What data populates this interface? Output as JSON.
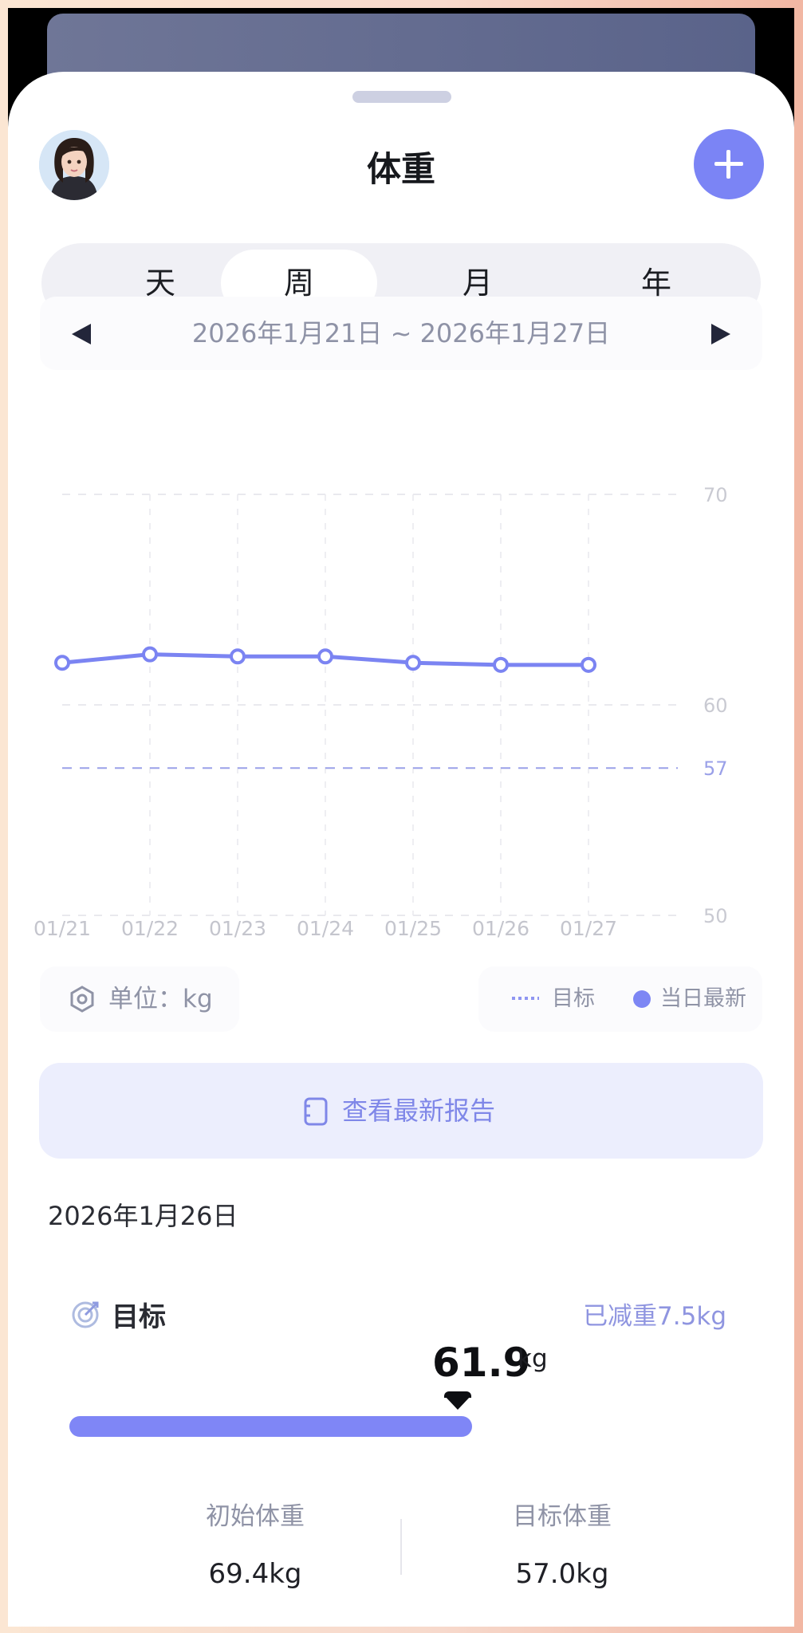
{
  "header": {
    "title": "体重"
  },
  "period_tabs": [
    "天",
    "周",
    "月",
    "年"
  ],
  "active_tab": "周",
  "date_range": "2026年1月21日 ~ 2026年1月27日",
  "chart_data": {
    "type": "line",
    "x": [
      "01/21",
      "01/22",
      "01/23",
      "01/24",
      "01/25",
      "01/26",
      "01/27"
    ],
    "series": [
      {
        "name": "当日最新",
        "values": [
          62.0,
          62.4,
          62.3,
          62.3,
          62.0,
          61.9,
          61.9
        ]
      }
    ],
    "target_line": 57,
    "y_ticks": [
      70,
      60,
      57,
      50
    ],
    "ylim": [
      50,
      70
    ],
    "grid": true,
    "colors": {
      "line": "#7b84f2",
      "target": "#9aa0e8",
      "grid": "#e9e9ee"
    }
  },
  "legend": {
    "unit": "单位：kg",
    "target": "目标",
    "latest": "当日最新"
  },
  "report_button": "查看最新报告",
  "selected_date": "2026年1月26日",
  "goal": {
    "label": "目标",
    "lost": "已减重7.5kg",
    "current_value": "61.9",
    "current_unit": "kg",
    "progress_fraction": 0.605
  },
  "stats": {
    "initial_label": "初始体重",
    "initial_value": "69.4kg",
    "target_label": "目标体重",
    "target_value": "57.0kg"
  },
  "colors": {
    "accent": "#7b84f5",
    "muted": "#8f93a6"
  }
}
